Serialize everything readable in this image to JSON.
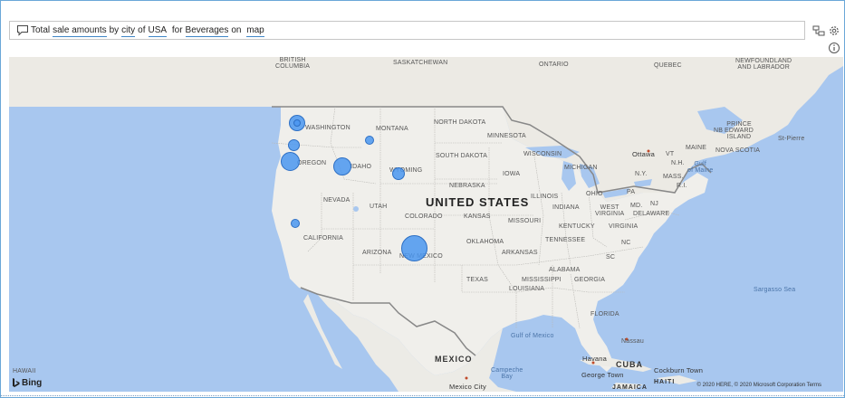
{
  "qa": {
    "icon": "speech-bubble-icon",
    "words": [
      "Total",
      "sale amounts",
      "by",
      "city",
      "of",
      "USA",
      "for",
      "Beverages",
      "on",
      "map"
    ]
  },
  "toolbar": {
    "icons": [
      "convert-visual-icon",
      "settings-gear-icon",
      "info-icon"
    ]
  },
  "map": {
    "labels": {
      "british_columbia": "BRITISH\nCOLUMBIA",
      "saskatchewan": "SASKATCHEWAN",
      "ontario": "ONTARIO",
      "quebec": "QUEBEC",
      "newfoundland": "NEWFOUNDLAND\nAND LABRADOR",
      "washington": "WASHINGTON",
      "montana": "MONTANA",
      "north_dakota": "NORTH DAKOTA",
      "minnesota": "MINNESOTA",
      "oregon": "OREGON",
      "idaho": "IDAHO",
      "south_dakota": "SOUTH DAKOTA",
      "wisconsin": "WISCONSIN",
      "michigan": "MICHIGAN",
      "wyoming": "WYOMING",
      "iowa": "IOWA",
      "nebraska": "NEBRASKA",
      "nevada": "NEVADA",
      "utah": "UTAH",
      "united_states": "UNITED STATES",
      "illinois": "ILLINOIS",
      "indiana": "INDIANA",
      "ohio": "OHIO",
      "pa": "PA",
      "colorado": "COLORADO",
      "kansas": "KANSAS",
      "missouri": "MISSOURI",
      "kentucky": "KENTUCKY",
      "west_virginia": "WEST\nVIRGINIA",
      "virginia": "VIRGINIA",
      "md": "MD.",
      "delaware": "DELAWARE",
      "nj": "NJ",
      "california": "CALIFORNIA",
      "arizona": "ARIZONA",
      "new_mexico": "NEW MEXICO",
      "oklahoma": "OKLAHOMA",
      "tennessee": "TENNESSEE",
      "nc": "NC",
      "arkansas": "ARKANSAS",
      "sc": "SC",
      "alabama": "ALABAMA",
      "mississippi": "MISSISSIPPI",
      "georgia": "GEORGIA",
      "texas": "TEXAS",
      "louisiana": "LOUISIANA",
      "florida": "FLORIDA",
      "ottawa": "Ottawa",
      "vt": "VT",
      "nh": "N.H.",
      "maine": "MAINE",
      "ny": "N.Y.",
      "mass": "MASS.",
      "ri": "R.I.",
      "prince_edward": "PRINCE\nEDWARD\nISLAND",
      "nb": "NB",
      "nova_scotia": "NOVA SCOTIA",
      "st_pierre": "St-Pierre",
      "gulf_of_maine": "Gulf\nof Maine",
      "sargasso": "Sargasso Sea",
      "gulf_of_mexico": "Gulf of Mexico",
      "nassau": "Nassau",
      "cuba": "CUBA",
      "havana": "Havana",
      "mexico": "MEXICO",
      "campeche": "Campeche\nBay",
      "george_town": "George Town",
      "cockburn": "Cockburn Town",
      "haiti": "HAITI",
      "jamaica": "JAMAICA",
      "mexico_city": "Mexico City",
      "hawaii": "HAWAII"
    },
    "bubbles": [
      {
        "city": "Seattle",
        "value": 3
      },
      {
        "city": "Tacoma",
        "value": 1
      },
      {
        "city": "Portland",
        "value": 2
      },
      {
        "city": "Eugene",
        "value": 4
      },
      {
        "city": "Boise",
        "value": 4
      },
      {
        "city": "Billings",
        "value": 1
      },
      {
        "city": "Casper",
        "value": 2
      },
      {
        "city": "San Francisco",
        "value": 1
      },
      {
        "city": "Albuquerque",
        "value": 9
      }
    ],
    "bing_label": "Bing",
    "copyright": "© 2020 HERE, © 2020 Microsoft Corporation  Terms"
  }
}
